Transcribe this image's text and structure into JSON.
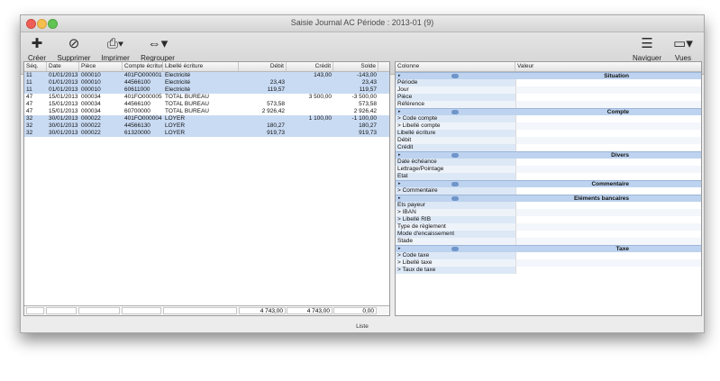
{
  "window": {
    "title": "Saisie Journal AC Période : 2013-01 (9)"
  },
  "toolbar": {
    "creer": "Créer",
    "supprimer": "Supprimer",
    "imprimer": "Imprimer",
    "regrouper": "Regrouper",
    "naviguer": "Naviguer",
    "vues": "Vues"
  },
  "table": {
    "headers": [
      "Séq.",
      "Date",
      "Pièce",
      "Compte écriture",
      "Libellé écriture",
      "Débit",
      "Crédit",
      "Solde"
    ],
    "rows": [
      {
        "seq": "11",
        "date": "01/01/2013",
        "piece": "000010",
        "compte": "401FO000001",
        "libelle": "Electricité",
        "debit": "",
        "credit": "143,00",
        "solde": "-143,00",
        "hl": true
      },
      {
        "seq": "11",
        "date": "01/01/2013",
        "piece": "000010",
        "compte": "44566100",
        "libelle": "Electricité",
        "debit": "23,43",
        "credit": "",
        "solde": "23,43",
        "hl": true
      },
      {
        "seq": "11",
        "date": "01/01/2013",
        "piece": "000010",
        "compte": "60611000",
        "libelle": "Electricité",
        "debit": "119,57",
        "credit": "",
        "solde": "119,57",
        "hl": true
      },
      {
        "seq": "47",
        "date": "15/01/2013",
        "piece": "000034",
        "compte": "401FO000005",
        "libelle": "TOTAL BUREAU",
        "debit": "",
        "credit": "3 500,00",
        "solde": "-3 500,00",
        "hl": false
      },
      {
        "seq": "47",
        "date": "15/01/2013",
        "piece": "000034",
        "compte": "44566100",
        "libelle": "TOTAL BUREAU",
        "debit": "573,58",
        "credit": "",
        "solde": "573,58",
        "hl": false
      },
      {
        "seq": "47",
        "date": "15/01/2013",
        "piece": "000034",
        "compte": "60700000",
        "libelle": "TOTAL BUREAU",
        "debit": "2 926,42",
        "credit": "",
        "solde": "2 926,42",
        "hl": false
      },
      {
        "seq": "32",
        "date": "30/01/2013",
        "piece": "000022",
        "compte": "401FO000004",
        "libelle": "LOYER",
        "debit": "",
        "credit": "1 100,00",
        "solde": "-1 100,00",
        "hl": true
      },
      {
        "seq": "32",
        "date": "30/01/2013",
        "piece": "000022",
        "compte": "44566130",
        "libelle": "LOYER",
        "debit": "180,27",
        "credit": "",
        "solde": "180,27",
        "hl": true
      },
      {
        "seq": "32",
        "date": "30/01/2013",
        "piece": "000022",
        "compte": "61320000",
        "libelle": "LOYER",
        "debit": "919,73",
        "credit": "",
        "solde": "919,73",
        "hl": true
      }
    ],
    "totals": {
      "debit": "4 743,00",
      "credit": "4 743,00",
      "solde": "0,00"
    }
  },
  "props": {
    "headers": [
      "Colonne",
      "Valeur"
    ],
    "sections": [
      {
        "title": "Situation",
        "items": [
          "Période",
          "Jour",
          "Pièce",
          "Référence"
        ]
      },
      {
        "title": "Compte",
        "items": [
          "> Code compte",
          "> Libellé compte",
          "Libellé écriture",
          "Débit",
          "Crédit"
        ]
      },
      {
        "title": "Divers",
        "items": [
          "Date échéance",
          "Lettrage/Pointage",
          "Etat"
        ]
      },
      {
        "title": "Commentaire",
        "items": [
          "> Commentaire"
        ]
      },
      {
        "title": "Eléments bancaires",
        "items": [
          "Ets payeur",
          "> IBAN",
          "> Libellé RIB",
          "Type de règlement",
          "Mode d'encaissement",
          "Stade"
        ]
      },
      {
        "title": "Taxe",
        "items": [
          "> Code taxe",
          "> Libellé taxe",
          "> Taux de taxe"
        ]
      }
    ]
  },
  "status": {
    "label": "Liste"
  }
}
